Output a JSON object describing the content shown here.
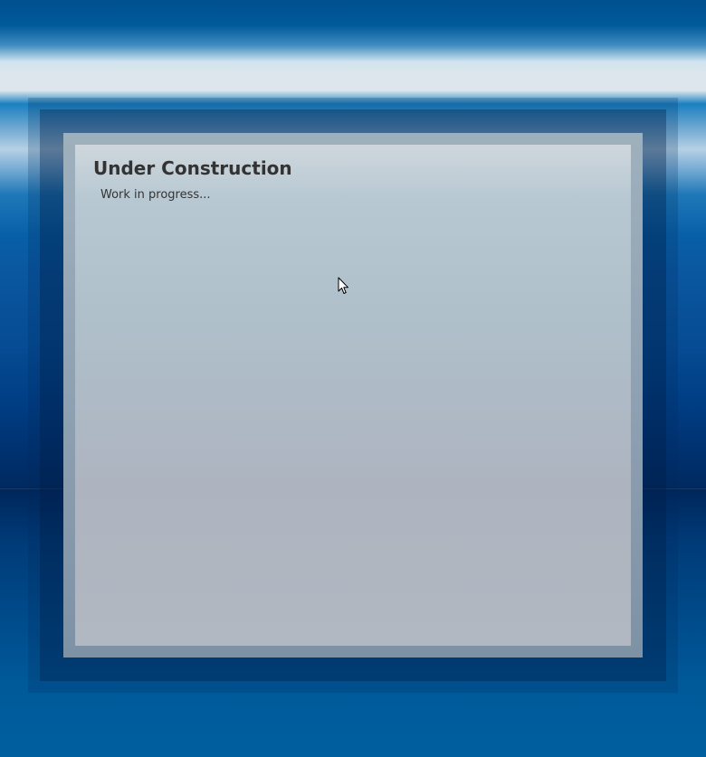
{
  "page": {
    "title": "Under Construction",
    "subtitle": "Work in progress..."
  },
  "colors": {
    "background_accent": "#005a9a",
    "panel_background": "#b7c8d2",
    "text": "#333333"
  },
  "icons": {
    "cursor": "mouse-pointer-icon"
  }
}
